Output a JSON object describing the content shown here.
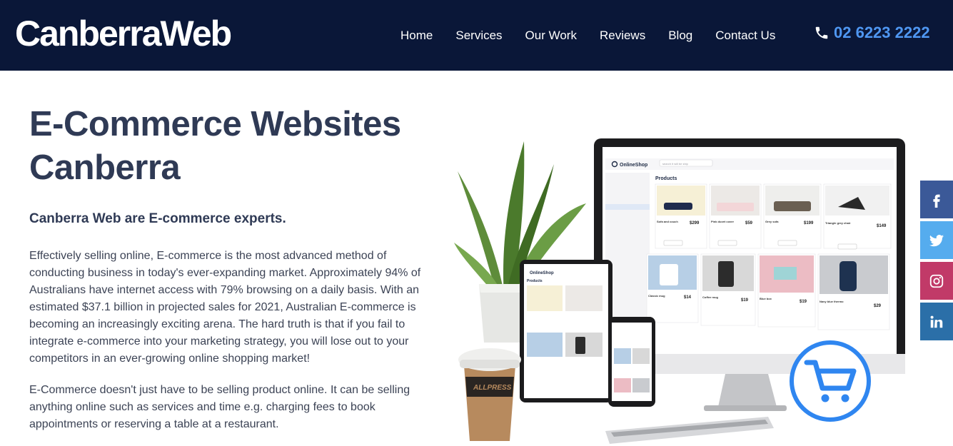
{
  "header": {
    "logo": "CanberraWeb",
    "nav": [
      "Home",
      "Services",
      "Our Work",
      "Reviews",
      "Blog",
      "Contact Us"
    ],
    "phone": "02 6223 2222"
  },
  "hero": {
    "title_line1": "E-Commerce Websites",
    "title_line2": "Canberra",
    "subheading": "Canberra Web are E-commerce experts.",
    "paragraph1": "Effectively selling online, E-commerce is the most advanced method of conducting business in today's ever-expanding market. Approximately 94% of Australians have internet access with 79% browsing on a daily basis. With an estimated $37.1 billion in projected sales for 2021, Australian E-commerce is becoming an increasingly exciting arena. The hard truth is that if you fail to integrate e-commerce into your marketing strategy, you will lose out to your competitors in an ever-growing online shopping market!",
    "paragraph2": "E-Commerce doesn't just have to be selling product online. It can be selling anything online such as services and time e.g. charging fees to book appointments or reserving a table at a restaurant."
  },
  "mockup": {
    "brand": "OnlineShop",
    "products_heading": "Products",
    "search_placeholder": "search it will be ship",
    "add_to_cart": "ADD TO CART",
    "cup_brand": "ALLPRESS",
    "products": [
      {
        "name": "Sofa and couch",
        "price": "$299"
      },
      {
        "name": "Pink duvet cover",
        "price": "$59"
      },
      {
        "name": "Grey sofa",
        "price": "$199"
      },
      {
        "name": "Triangle grey chair",
        "price": "$149"
      },
      {
        "name": "Classic mug",
        "price": "$14"
      },
      {
        "name": "Coffee mug",
        "price": "$19"
      },
      {
        "name": "Blue box",
        "price": "$19"
      },
      {
        "name": "Navy blue thermo",
        "price": "$29"
      }
    ]
  },
  "social": [
    {
      "icon": "facebook-icon",
      "label": "f"
    },
    {
      "icon": "twitter-icon",
      "label": "twitter"
    },
    {
      "icon": "instagram-icon",
      "label": "instagram"
    },
    {
      "icon": "linkedin-icon",
      "label": "in"
    }
  ],
  "colors": {
    "nav_bg": "#0a1738",
    "phone": "#4f97f2",
    "heading": "#2f3a55",
    "cart_accent": "#2f86f0",
    "facebook": "#3b5998",
    "twitter": "#55acee",
    "instagram": "#c13a68",
    "linkedin": "#2b6fa8"
  }
}
